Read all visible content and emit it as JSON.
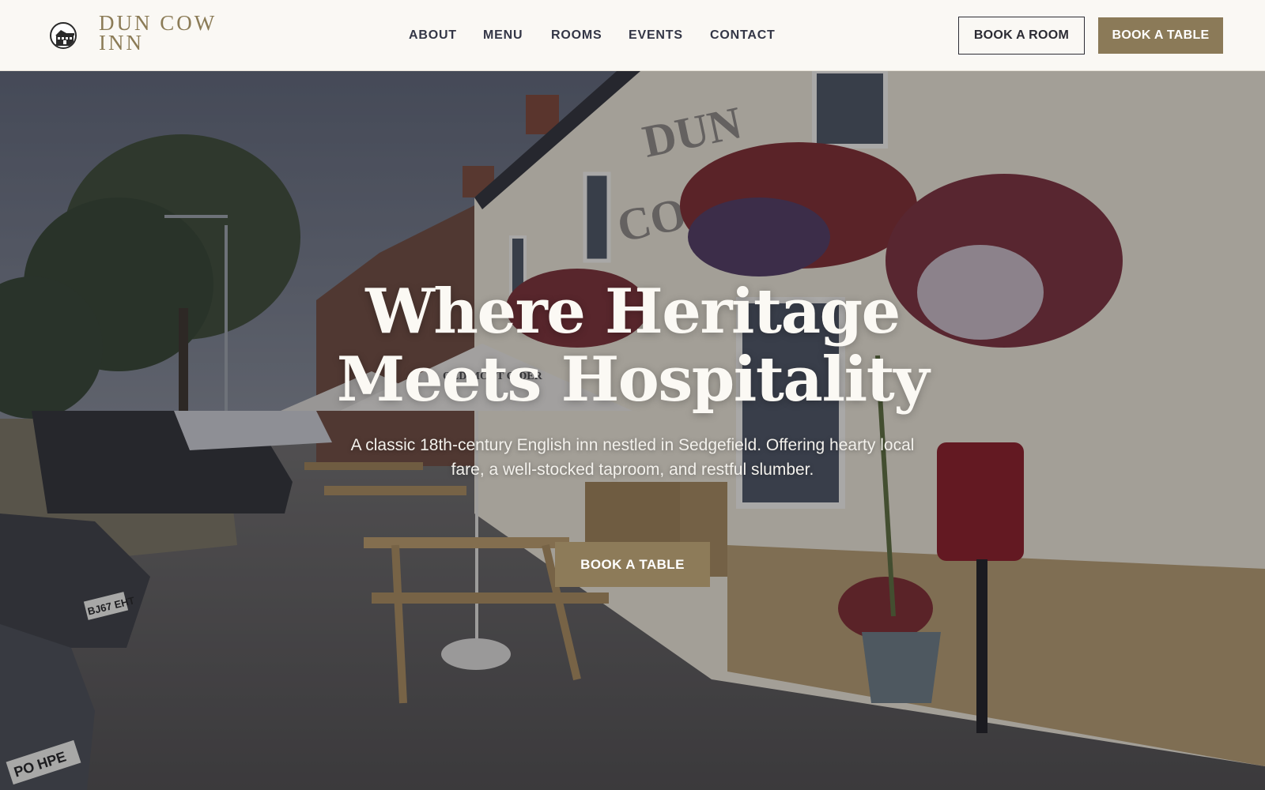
{
  "brand": {
    "logo_icon": "inn-building-logo-icon",
    "name_line1": "DUN COW",
    "name_line2": "INN"
  },
  "nav": {
    "items": [
      {
        "label": "ABOUT"
      },
      {
        "label": "MENU"
      },
      {
        "label": "ROOMS"
      },
      {
        "label": "EVENTS"
      },
      {
        "label": "CONTACT"
      }
    ]
  },
  "header_actions": {
    "book_room_label": "BOOK A ROOM",
    "book_table_label": "BOOK A TABLE"
  },
  "hero": {
    "title": "Where Heritage Meets Hospitality",
    "subtitle": "A classic 18th-century English inn nestled in Sedgefield. Offering hearty local fare, a well-stocked taproom, and restful slumber.",
    "cta_label": "BOOK A TABLE",
    "image": {
      "sign_line1": "DUN",
      "sign_line2": "COW INN",
      "umbrella_text": "OLD MOUT CIDER",
      "plate_1": "BJ67 EHT",
      "plate_2": "PO HPE"
    }
  },
  "colors": {
    "accent": "#8b7a58",
    "logo_text": "#8b7b56",
    "nav_text": "#333646",
    "header_bg": "#faf8f4"
  }
}
